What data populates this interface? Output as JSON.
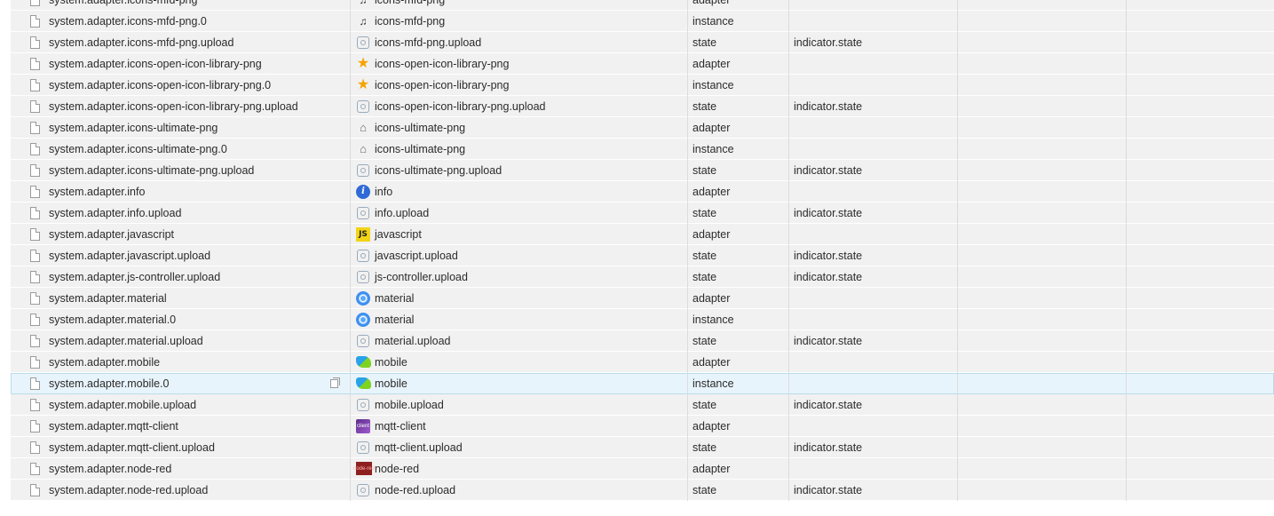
{
  "rows": [
    {
      "id": "system.adapter.icons-mfd-png",
      "name": "icons-mfd-png",
      "type": "adapter",
      "role": "",
      "icon": "bell-icon"
    },
    {
      "id": "system.adapter.icons-mfd-png.0",
      "name": "icons-mfd-png",
      "type": "instance",
      "role": "",
      "icon": "bell-icon"
    },
    {
      "id": "system.adapter.icons-mfd-png.upload",
      "name": "icons-mfd-png.upload",
      "type": "state",
      "role": "indicator.state",
      "icon": "upload-icon"
    },
    {
      "id": "system.adapter.icons-open-icon-library-png",
      "name": "icons-open-icon-library-png",
      "type": "adapter",
      "role": "",
      "icon": "star-icon"
    },
    {
      "id": "system.adapter.icons-open-icon-library-png.0",
      "name": "icons-open-icon-library-png",
      "type": "instance",
      "role": "",
      "icon": "star-icon"
    },
    {
      "id": "system.adapter.icons-open-icon-library-png.upload",
      "name": "icons-open-icon-library-png.upload",
      "type": "state",
      "role": "indicator.state",
      "icon": "upload-icon"
    },
    {
      "id": "system.adapter.icons-ultimate-png",
      "name": "icons-ultimate-png",
      "type": "adapter",
      "role": "",
      "icon": "home-icon"
    },
    {
      "id": "system.adapter.icons-ultimate-png.0",
      "name": "icons-ultimate-png",
      "type": "instance",
      "role": "",
      "icon": "home-icon"
    },
    {
      "id": "system.adapter.icons-ultimate-png.upload",
      "name": "icons-ultimate-png.upload",
      "type": "state",
      "role": "indicator.state",
      "icon": "upload-icon"
    },
    {
      "id": "system.adapter.info",
      "name": "info",
      "type": "adapter",
      "role": "",
      "icon": "info-icon"
    },
    {
      "id": "system.adapter.info.upload",
      "name": "info.upload",
      "type": "state",
      "role": "indicator.state",
      "icon": "upload-icon"
    },
    {
      "id": "system.adapter.javascript",
      "name": "javascript",
      "type": "adapter",
      "role": "",
      "icon": "javascript-icon"
    },
    {
      "id": "system.adapter.javascript.upload",
      "name": "javascript.upload",
      "type": "state",
      "role": "indicator.state",
      "icon": "upload-icon"
    },
    {
      "id": "system.adapter.js-controller.upload",
      "name": "js-controller.upload",
      "type": "state",
      "role": "indicator.state",
      "icon": "upload-icon"
    },
    {
      "id": "system.adapter.material",
      "name": "material",
      "type": "adapter",
      "role": "",
      "icon": "material-icon"
    },
    {
      "id": "system.adapter.material.0",
      "name": "material",
      "type": "instance",
      "role": "",
      "icon": "material-icon"
    },
    {
      "id": "system.adapter.material.upload",
      "name": "material.upload",
      "type": "state",
      "role": "indicator.state",
      "icon": "upload-icon"
    },
    {
      "id": "system.adapter.mobile",
      "name": "mobile",
      "type": "adapter",
      "role": "",
      "icon": "mobile-icon"
    },
    {
      "id": "system.adapter.mobile.0",
      "name": "mobile",
      "type": "instance",
      "role": "",
      "icon": "mobile-icon",
      "selected": true
    },
    {
      "id": "system.adapter.mobile.upload",
      "name": "mobile.upload",
      "type": "state",
      "role": "indicator.state",
      "icon": "upload-icon"
    },
    {
      "id": "system.adapter.mqtt-client",
      "name": "mqtt-client",
      "type": "adapter",
      "role": "",
      "icon": "mqtt-client-icon"
    },
    {
      "id": "system.adapter.mqtt-client.upload",
      "name": "mqtt-client.upload",
      "type": "state",
      "role": "indicator.state",
      "icon": "upload-icon"
    },
    {
      "id": "system.adapter.node-red",
      "name": "node-red",
      "type": "adapter",
      "role": "",
      "icon": "node-red-icon"
    },
    {
      "id": "system.adapter.node-red.upload",
      "name": "node-red.upload",
      "type": "state",
      "role": "indicator.state",
      "icon": "upload-icon"
    }
  ],
  "icon_glyphs": {
    "bell-icon": "♫",
    "upload-icon": "",
    "star-icon": "★",
    "home-icon": "⌂",
    "info-icon": "i",
    "javascript-icon": "JS",
    "material-icon": "",
    "mobile-icon": "",
    "mqtt-client-icon": "client",
    "node-red-icon": "node-red"
  }
}
